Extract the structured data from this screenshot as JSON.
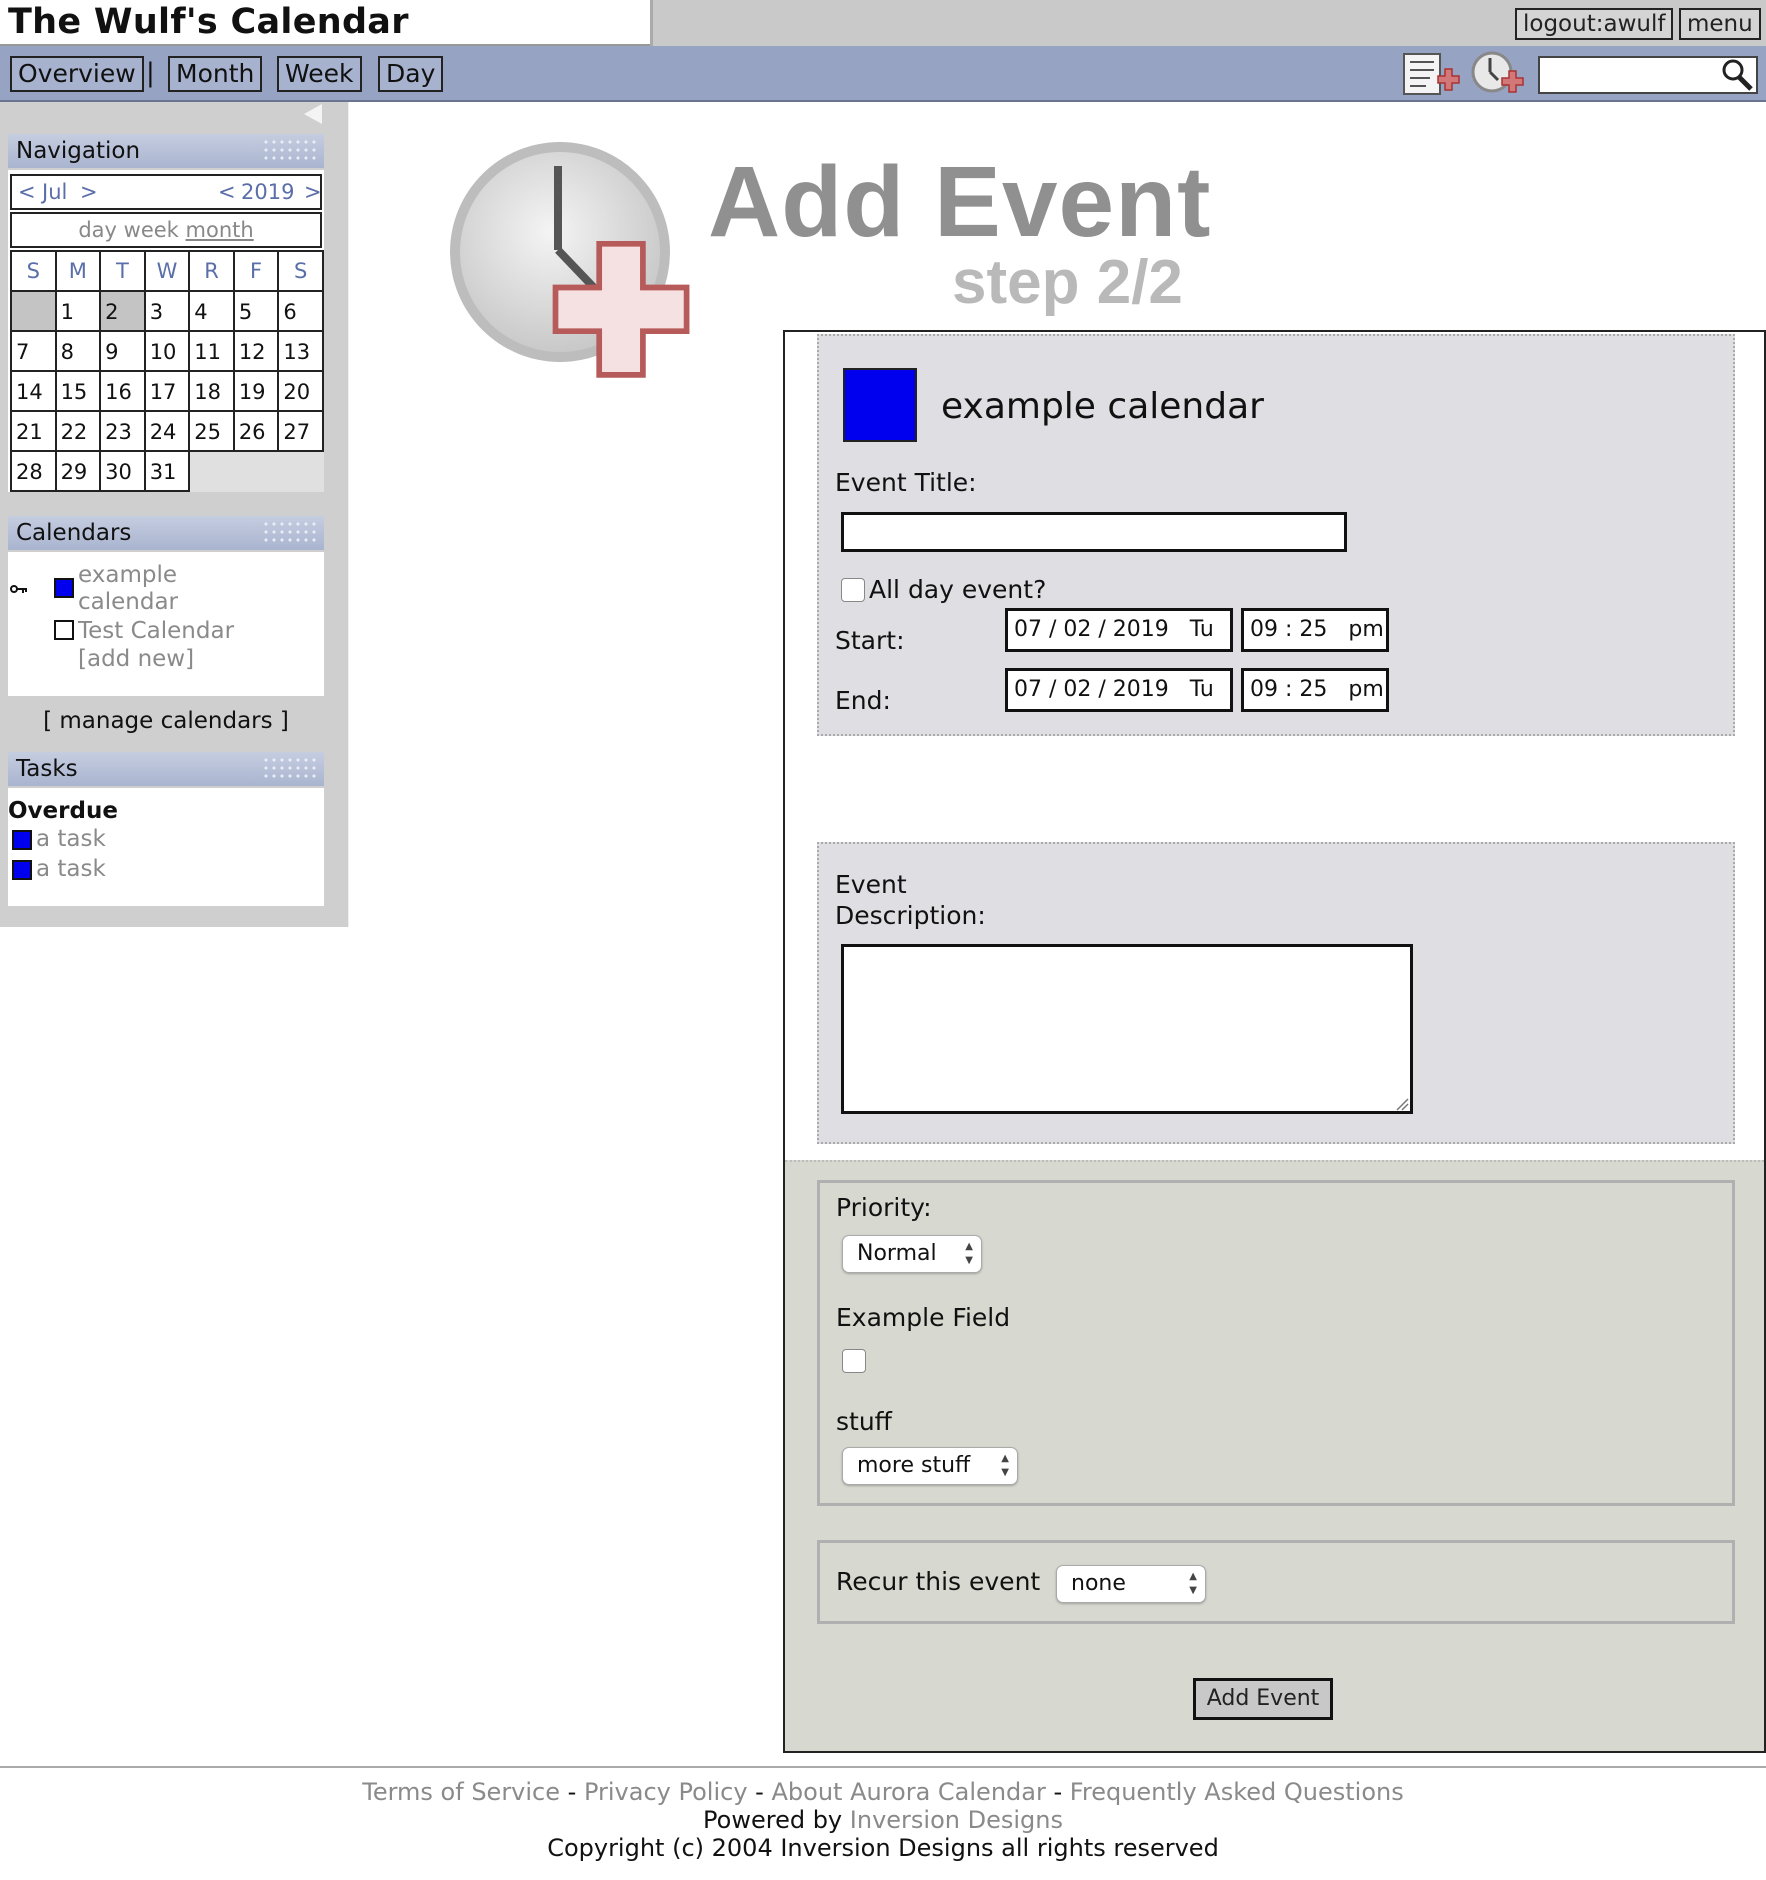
{
  "app_title": "The Wulf's Calendar",
  "top": {
    "logout_label": "logout:awulf",
    "menu_label": "menu"
  },
  "nav": {
    "overview": "Overview",
    "separator": "|",
    "month": "Month",
    "week": "Week",
    "day": "Day",
    "search_value": ""
  },
  "sidebar": {
    "navigation": {
      "title": "Navigation",
      "month_prev": "<",
      "month_label": "Jul",
      "month_next": ">",
      "year_prev": "<",
      "year_label": "2019",
      "year_next": ">",
      "view_day": "day",
      "view_week": "week",
      "view_month": "month",
      "weekdays": [
        "S",
        "M",
        "T",
        "W",
        "R",
        "F",
        "S"
      ],
      "weeks": [
        [
          "",
          "1",
          "2",
          "3",
          "4",
          "5",
          "6"
        ],
        [
          "7",
          "8",
          "9",
          "10",
          "11",
          "12",
          "13"
        ],
        [
          "14",
          "15",
          "16",
          "17",
          "18",
          "19",
          "20"
        ],
        [
          "21",
          "22",
          "23",
          "24",
          "25",
          "26",
          "27"
        ],
        [
          "28",
          "29",
          "30",
          "31",
          "",
          "",
          ""
        ]
      ],
      "today": "2"
    },
    "calendars": {
      "title": "Calendars",
      "items": [
        {
          "label": "example calendar",
          "color": "#0000ee",
          "key_icon": "key-icon"
        },
        {
          "label": "Test Calendar",
          "color": "#ffffff"
        }
      ],
      "add_new": "[add new]",
      "manage": "[ manage calendars ]"
    },
    "tasks": {
      "title": "Tasks",
      "section": "Overdue",
      "items": [
        {
          "label": "a task",
          "color": "#0000ee"
        },
        {
          "label": "a task",
          "color": "#0000ee"
        }
      ]
    }
  },
  "main": {
    "heading": "Add Event",
    "subheading": "step 2/2",
    "calendar_name": "example calendar",
    "calendar_color": "#0000ee",
    "event_title_label": "Event Title:",
    "event_title_value": "",
    "all_day_label": "All day event?",
    "start_label": "Start:",
    "end_label": "End:",
    "start_date": "07 / 02 / 2019   Tu",
    "start_time": "09 : 25   pm",
    "end_date": "07 / 02 / 2019   Tu",
    "end_time": "09 : 25   pm",
    "description_label_1": "Event",
    "description_label_2": "Description:",
    "description_value": "",
    "priority_label": "Priority:",
    "priority_value": "Normal",
    "example_field_label": "Example Field",
    "stuff_label": "stuff",
    "stuff_value": "more stuff",
    "recur_label": "Recur this event",
    "recur_value": "none",
    "submit_label": "Add Event"
  },
  "footer": {
    "links": [
      "Terms of Service",
      "Privacy Policy",
      "About Aurora Calendar",
      "Frequently Asked Questions"
    ],
    "sep": "-",
    "powered_by": "Powered by",
    "powered_link": "Inversion Designs",
    "copyright": "Copyright (c) 2004 Inversion Designs all rights reserved"
  }
}
